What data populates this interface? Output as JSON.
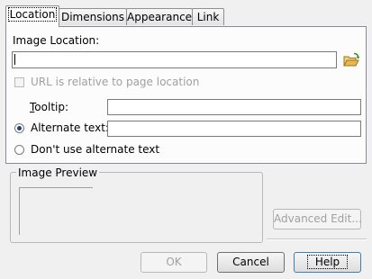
{
  "tabs": [
    {
      "label": "Location",
      "active": true
    },
    {
      "label": "Dimensions",
      "active": false
    },
    {
      "label": "Appearance",
      "active": false
    },
    {
      "label": "Link",
      "active": false
    }
  ],
  "location": {
    "image_location_label": "Image Location:",
    "image_location_value": "",
    "relative_url_label": "URL is relative to page location",
    "relative_url_checked": false,
    "tooltip_label": "Tooltip:",
    "tooltip_value": "",
    "alt_text_label": "Alternate text:",
    "alt_text_value": "",
    "alt_text_selected": true,
    "no_alt_label": "Don't use alternate text",
    "no_alt_selected": false
  },
  "preview": {
    "title": "Image Preview",
    "advanced_edit_label": "Advanced Edit..."
  },
  "footer": {
    "ok_label": "OK",
    "cancel_label": "Cancel",
    "help_label": "Help"
  },
  "colors": {
    "folder_icon": "#e8b84a",
    "folder_arrow": "#2a9a2a"
  }
}
